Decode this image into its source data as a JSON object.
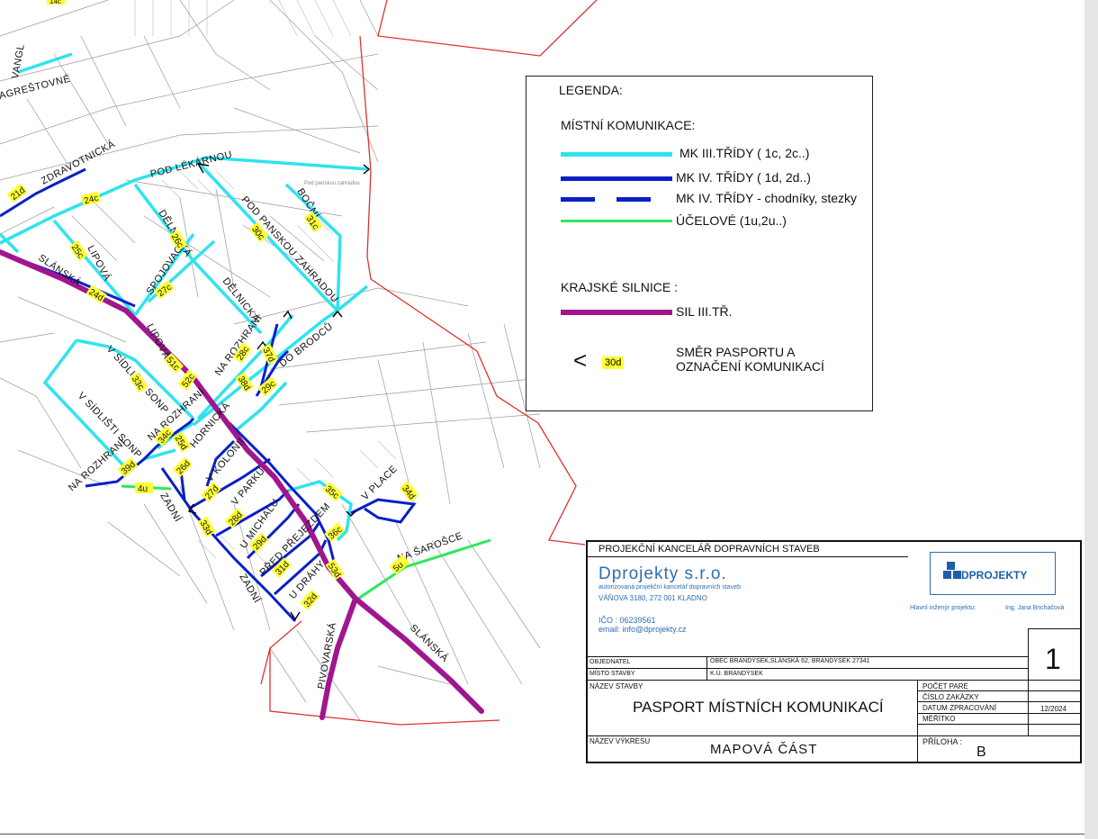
{
  "map": {
    "street_labels": [
      "VANGL",
      "AGREŠTOVNÉ",
      "ZDRAVOTNICKÁ",
      "POD LÉKÁRNOU",
      "BOČNÍ",
      "POD PANSKOU ZAHRADOU",
      "DĚLNICKÁ",
      "DĚLNICKÁ",
      "SPOJOVACÍ",
      "LIPOVÁ",
      "LIPOVÁ",
      "SLÁNSKÁ",
      "NA ROZHRANÍ",
      "DO BRODCŮ",
      "V SÍDLIŠTI SONP",
      "V SÍDLIŠTI SONP",
      "NA ROZHRANÍ",
      "HORNICKÁ",
      "NA ROZHRANÍ",
      "ZADNÍ",
      "V KOLONII",
      "V PARKU",
      "U MICHALU",
      "PŘED PŘEJEZDEM",
      "ZADNÍ",
      "U DRÁHY",
      "V PLACE",
      "NA ŠAROŠCE",
      "SLÁNSKÁ",
      "PIVOVARSKÁ"
    ],
    "road_tags": [
      "21d",
      "24c",
      "25c",
      "26c",
      "27c",
      "24d",
      "30c",
      "31c",
      "51c",
      "52c",
      "33c",
      "38d",
      "28c",
      "37d",
      "29c",
      "34c",
      "25d",
      "26d",
      "39d",
      "4u",
      "27d",
      "28d",
      "33d",
      "29d",
      "31d",
      "32d",
      "53d",
      "36c",
      "35c",
      "34d",
      "5u"
    ],
    "top_tag": "14c",
    "faint_label": "Pod panskou zahradou"
  },
  "legend": {
    "title": "LEGENDA:",
    "section_local": "MÍSTNÍ KOMUNIKACE:",
    "item_mk3": "MK III.TŘÍDY ( 1c, 2c..)",
    "item_mk4": "MK IV. TŘÍDY ( 1d, 2d..)",
    "item_mk4_paths": "MK IV. TŘÍDY - chodníky, stezky",
    "item_ucelove": "ÚČELOVÉ (1u,2u..)",
    "section_regional": "KRAJSKÉ SILNICE :",
    "item_sil3": "SIL III.TŘ.",
    "arrow_glyph": "<",
    "sample_tag": "30d",
    "direction_line1": "SMĚR  PASPORTU A",
    "direction_line2": "OZNAČENÍ KOMUNIKACÍ"
  },
  "colors": {
    "mk3": "#2fe3ee",
    "mk4": "#0a1fc8",
    "ucelove": "#2ee85a",
    "sil3": "#a0168e",
    "boundary": "#e03030",
    "tag": "#ffff33"
  },
  "title_block": {
    "office": "PROJEKČNÍ KANCELÁŘ  DOPRAVNÍCH STAVEB",
    "company": "Dprojekty s.r.o.",
    "company_sub": "autorizovaná projekční kancelář dopravních staveb",
    "address": "VÁŇOVA 3180, 272 001 KLADNO",
    "ico": "IČO : 06239561",
    "email": "email: info@dprojekty.cz",
    "logo_text": "DPROJEKTY",
    "chief_engineer_label": "Hlavní inženýr projektu:",
    "chief_engineer": "Ing. Jana Brichačová",
    "client_label": "OBJEDNATEL",
    "client": "OBEC BRANDÝSEK,SLÁNSKÁ 62, BRANDÝSEK  27341",
    "site_label": "MÍSTO STAVBY",
    "site": "K.Ú. BRANDÝSEK",
    "sheet_number": "1",
    "project_label": "NÁZEV STAVBY",
    "project": "PASPORT MÍSTNÍCH KOMUNIKACÍ",
    "copies_label": "POČET PARÉ",
    "order_label": "ČÍSLO ZAKÁZKY",
    "date_label": "DATUM ZPRACOVÁNÍ",
    "date": "12/2024",
    "scale_label": "MĚŘÍTKO",
    "drawing_label": "NÁZEV VÝKRESU",
    "drawing": "MAPOVÁ ČÁST",
    "attachment_label": "PŘÍLOHA :",
    "attachment": "B"
  }
}
